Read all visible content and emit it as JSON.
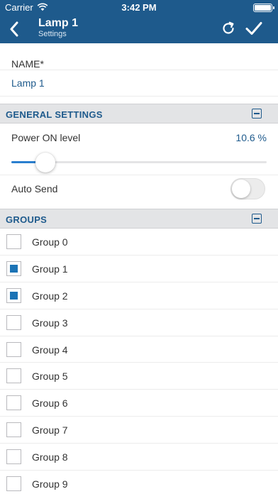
{
  "status_bar": {
    "carrier": "Carrier",
    "time": "3:42 PM"
  },
  "nav": {
    "title": "Lamp 1",
    "subtitle": "Settings",
    "back_icon": "chevron-left-icon",
    "refresh_icon": "refresh-icon",
    "confirm_icon": "checkmark-icon"
  },
  "name_field": {
    "label": "NAME*",
    "value": "Lamp 1"
  },
  "general_settings": {
    "title": "GENERAL SETTINGS",
    "power_on_level": {
      "label": "Power ON level",
      "value_text": "10.6 %",
      "percent": 10.6
    },
    "auto_send": {
      "label": "Auto Send",
      "enabled": false
    }
  },
  "groups": {
    "title": "GROUPS",
    "items": [
      {
        "label": "Group 0",
        "checked": false
      },
      {
        "label": "Group 1",
        "checked": true
      },
      {
        "label": "Group 2",
        "checked": true
      },
      {
        "label": "Group 3",
        "checked": false
      },
      {
        "label": "Group 4",
        "checked": false
      },
      {
        "label": "Group 5",
        "checked": false
      },
      {
        "label": "Group 6",
        "checked": false
      },
      {
        "label": "Group 7",
        "checked": false
      },
      {
        "label": "Group 8",
        "checked": false
      },
      {
        "label": "Group 9",
        "checked": false
      }
    ]
  },
  "colors": {
    "header_bg": "#1e5a8c",
    "accent": "#1b73b5",
    "section_bg": "#e3e4e6"
  }
}
